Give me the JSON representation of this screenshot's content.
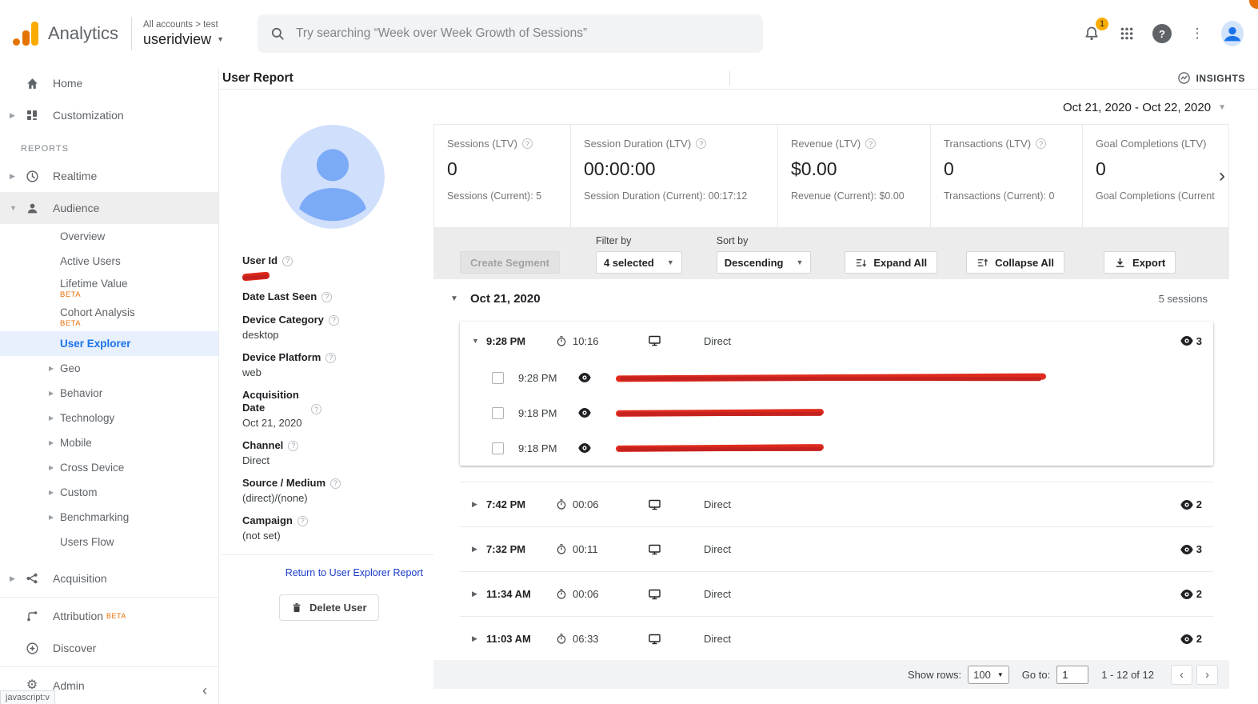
{
  "header": {
    "app_name": "Analytics",
    "breadcrumb": "All accounts > test",
    "view_name": "useridview",
    "search_placeholder": "Try searching “Week over Week Growth of Sessions”",
    "notification_badge": "1"
  },
  "sidebar": {
    "home": "Home",
    "customization": "Customization",
    "reports_label": "REPORTS",
    "realtime": "Realtime",
    "audience": "Audience",
    "audience_children": [
      {
        "label": "Overview"
      },
      {
        "label": "Active Users"
      },
      {
        "label": "Lifetime Value",
        "badge": "BETA"
      },
      {
        "label": "Cohort Analysis",
        "badge": "BETA"
      },
      {
        "label": "User Explorer"
      },
      {
        "label": "Geo"
      },
      {
        "label": "Behavior"
      },
      {
        "label": "Technology"
      },
      {
        "label": "Mobile"
      },
      {
        "label": "Cross Device"
      },
      {
        "label": "Custom"
      },
      {
        "label": "Benchmarking"
      },
      {
        "label": "Users Flow"
      }
    ],
    "acquisition": "Acquisition",
    "attribution": "Attribution",
    "attribution_badge": "BETA",
    "discover": "Discover",
    "admin": "Admin",
    "status_text": "javascript:v"
  },
  "page": {
    "title": "User Report",
    "insights": "INSIGHTS",
    "date_range": "Oct 21, 2020 - Oct 22, 2020"
  },
  "user_panel": {
    "user_id_label": "User Id",
    "date_last_seen_label": "Date Last Seen",
    "device_category_label": "Device Category",
    "device_category_value": "desktop",
    "device_platform_label": "Device Platform",
    "device_platform_value": "web",
    "acquisition_date_label": "Acquisition Date",
    "acquisition_date_value": "Oct 21, 2020",
    "channel_label": "Channel",
    "channel_value": "Direct",
    "source_medium_label": "Source / Medium",
    "source_medium_value": "(direct)/(none)",
    "campaign_label": "Campaign",
    "campaign_value": "(not set)",
    "return_link": "Return to User Explorer Report",
    "delete_button": "Delete User"
  },
  "metrics": [
    {
      "label": "Sessions (LTV)",
      "value": "0",
      "sub": "Sessions (Current): 5"
    },
    {
      "label": "Session Duration (LTV)",
      "value": "00:00:00",
      "sub": "Session Duration (Current): 00:17:12"
    },
    {
      "label": "Revenue (LTV)",
      "value": "$0.00",
      "sub": "Revenue (Current): $0.00"
    },
    {
      "label": "Transactions (LTV)",
      "value": "0",
      "sub": "Transactions (Current): 0"
    },
    {
      "label": "Goal Completions (LTV)",
      "value": "0",
      "sub": "Goal Completions (Current"
    }
  ],
  "toolbar": {
    "create_segment": "Create Segment",
    "filter_by_label": "Filter by",
    "filter_value": "4 selected",
    "sort_by_label": "Sort by",
    "sort_value": "Descending",
    "expand_all": "Expand All",
    "collapse_all": "Collapse All",
    "export": "Export"
  },
  "sessions": {
    "group_date": "Oct 21, 2020",
    "group_count": "5 sessions",
    "expanded_session": {
      "time": "9:28 PM",
      "duration": "10:16",
      "channel": "Direct",
      "pageviews": "3",
      "hits": [
        {
          "time": "9:28 PM"
        },
        {
          "time": "9:18 PM"
        },
        {
          "time": "9:18 PM"
        }
      ]
    },
    "collapsed_sessions": [
      {
        "time": "7:42 PM",
        "duration": "00:06",
        "channel": "Direct",
        "pageviews": "2"
      },
      {
        "time": "7:32 PM",
        "duration": "00:11",
        "channel": "Direct",
        "pageviews": "3"
      },
      {
        "time": "11:34 AM",
        "duration": "00:06",
        "channel": "Direct",
        "pageviews": "2"
      },
      {
        "time": "11:03 AM",
        "duration": "06:33",
        "channel": "Direct",
        "pageviews": "2"
      }
    ]
  },
  "footer": {
    "show_rows_label": "Show rows:",
    "show_rows_value": "100",
    "goto_label": "Go to:",
    "goto_value": "1",
    "range_text": "1 - 12 of 12"
  }
}
